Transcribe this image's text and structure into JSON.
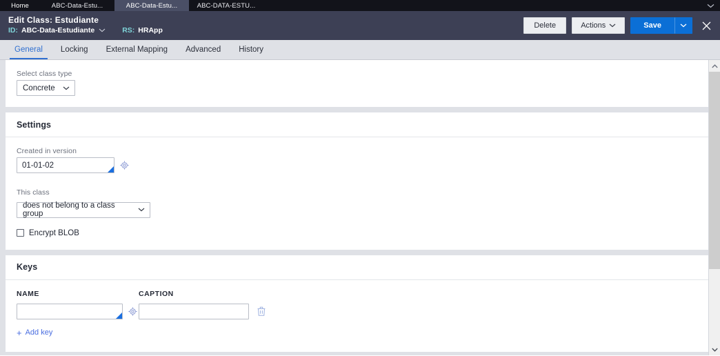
{
  "app_tabs": [
    {
      "label": "Home",
      "active": false
    },
    {
      "label": "ABC-Data-Estu...",
      "active": false
    },
    {
      "label": "ABC-Data-Estu...",
      "active": true
    },
    {
      "label": "ABC-DATA-ESTU...",
      "active": false
    }
  ],
  "header": {
    "title": "Edit Class: Estudiante",
    "id_label": "ID:",
    "id_value": "ABC-Data-Estudiante",
    "rs_label": "RS:",
    "rs_value": "HRApp",
    "delete_label": "Delete",
    "actions_label": "Actions",
    "save_label": "Save",
    "close_icon": "close-icon",
    "accent_blue": "#0b6fd6",
    "bar_color": "#3d4055",
    "teal_label": "#7fd4d8"
  },
  "tabnav": {
    "items": [
      {
        "label": "General",
        "active": true
      },
      {
        "label": "Locking",
        "active": false
      },
      {
        "label": "External Mapping",
        "active": false
      },
      {
        "label": "Advanced",
        "active": false
      },
      {
        "label": "History",
        "active": false
      }
    ],
    "active_color": "#2f6fd0"
  },
  "class_type": {
    "label": "Select class type",
    "value": "Concrete"
  },
  "settings": {
    "title": "Settings",
    "created_in_version": {
      "label": "Created in version",
      "value": "01-01-02",
      "picker_icon": "crosshair-icon"
    },
    "this_class": {
      "label": "This class",
      "value": "does not belong to a class group"
    },
    "encrypt_blob": {
      "label": "Encrypt BLOB",
      "checked": false
    }
  },
  "keys": {
    "title": "Keys",
    "columns": [
      "NAME",
      "CAPTION"
    ],
    "rows": [
      {
        "name": "",
        "caption": "",
        "picker_icon": "crosshair-icon",
        "delete_icon": "trash-icon"
      }
    ],
    "add_label": "Add key"
  },
  "scrollbar": {
    "up_icon": "chevron-up-icon",
    "down_icon": "chevron-down-icon"
  }
}
